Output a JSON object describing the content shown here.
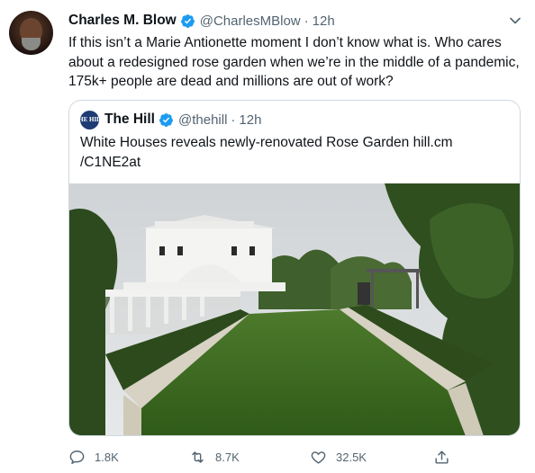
{
  "tweet": {
    "author_name": "Charles M. Blow",
    "author_handle": "@CharlesMBlow",
    "separator": "·",
    "time": "12h",
    "text": "If this isn’t a Marie Antionette moment I don’t know what is. Who cares about a redesigned rose garden when we’re in the middle of a pandemic, 175k+ people are dead and millions are out of work?"
  },
  "quoted": {
    "avatar_text": "THE HILL",
    "author_name": "The Hill",
    "author_handle": "@thehill",
    "separator": "·",
    "time": "12h",
    "text": "White Houses reveals newly-renovated Rose Garden hill.cm /C1NE2at"
  },
  "actions": {
    "reply_count": "1.8K",
    "retweet_count": "8.7K",
    "like_count": "32.5K"
  },
  "colors": {
    "verified": "#1d9bf0",
    "secondary_text": "#536471",
    "border": "#cfd9de"
  },
  "icons": [
    "verified-badge-icon",
    "chevron-down-icon",
    "reply-icon",
    "retweet-icon",
    "like-icon",
    "share-icon"
  ]
}
